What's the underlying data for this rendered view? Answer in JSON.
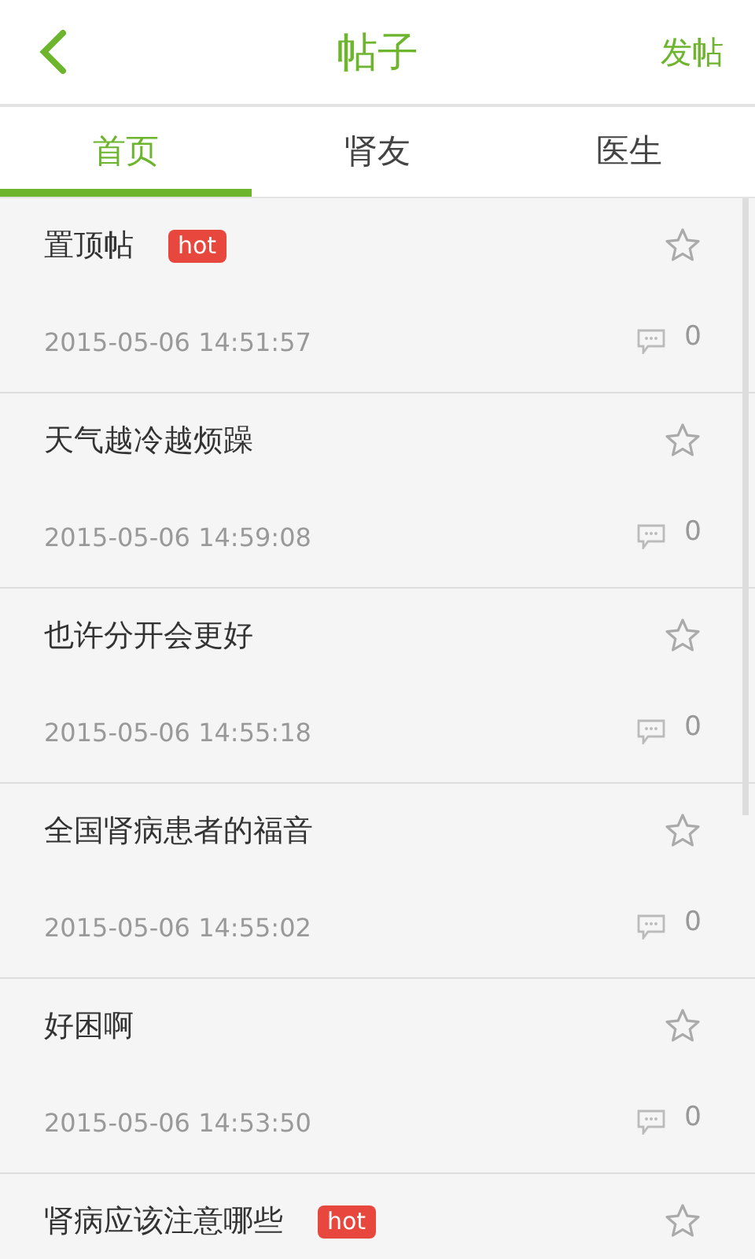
{
  "header": {
    "title": "帖子",
    "action": "发帖"
  },
  "tabs": [
    {
      "label": "首页",
      "selected": true
    },
    {
      "label": "肾友",
      "selected": false
    },
    {
      "label": "医生",
      "selected": false
    }
  ],
  "posts": [
    {
      "title": "置顶帖",
      "tag": "hot",
      "starred": false,
      "time": "2015-05-06 14:51:57",
      "comments": "0"
    },
    {
      "title": "天气越冷越烦躁",
      "starred": false,
      "time": "2015-05-06 14:59:08",
      "comments": "0"
    },
    {
      "title": "也许分开会更好",
      "starred": false,
      "time": "2015-05-06 14:55:18",
      "comments": "0"
    },
    {
      "title": "全国肾病患者的福音",
      "starred": false,
      "time": "2015-05-06 14:55:02",
      "comments": "0"
    },
    {
      "title": "好困啊",
      "starred": false,
      "time": "2015-05-06 14:53:50",
      "comments": "0"
    },
    {
      "title": "肾病应该注意哪些",
      "tag": "hot",
      "starred": false
    }
  ]
}
